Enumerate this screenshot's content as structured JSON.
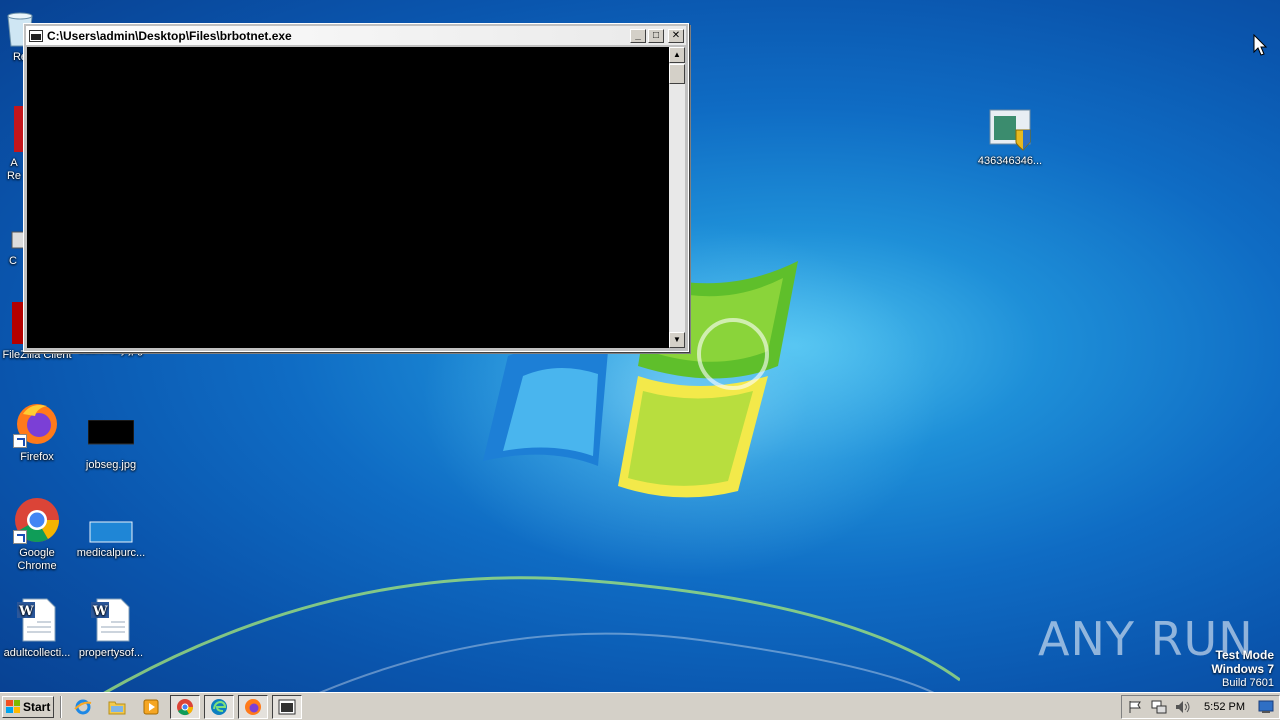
{
  "console": {
    "title": "C:\\Users\\admin\\Desktop\\Files\\brbotnet.exe",
    "minimize_label": "_",
    "maximize_label": "□",
    "close_label": "✕"
  },
  "desktop": {
    "icons": [
      {
        "id": "recycle-bin",
        "label": "Re"
      },
      {
        "id": "acrobat-reader",
        "label": "A\nRe"
      },
      {
        "id": "ccleaner",
        "label": "C"
      },
      {
        "id": "filezilla",
        "label": "FileZilla Client"
      },
      {
        "id": "backmary",
        "label": "backmary.jpg"
      },
      {
        "id": "firefox",
        "label": "Firefox"
      },
      {
        "id": "jobseg",
        "label": "jobseg.jpg"
      },
      {
        "id": "chrome",
        "label": "Google Chrome"
      },
      {
        "id": "medicalpurc",
        "label": "medicalpurc..."
      },
      {
        "id": "adultcollecti",
        "label": "adultcollecti..."
      },
      {
        "id": "propertysof",
        "label": "propertysof..."
      },
      {
        "id": "installer-436",
        "label": "436346346..."
      }
    ]
  },
  "watermark": {
    "text": "ANY RUN"
  },
  "os_notice": {
    "line1": "Test Mode",
    "line2": "Windows 7",
    "line3": "Build 7601"
  },
  "taskbar": {
    "start_label": "Start",
    "pinned": [
      "internet-explorer",
      "file-explorer",
      "media-player",
      "chrome",
      "edge",
      "firefox",
      "console"
    ],
    "clock": "5:52 PM"
  },
  "colors": {
    "desktop_blue": "#0f6cc4",
    "taskbar_gray": "#d4d0c8",
    "console_black": "#000000"
  }
}
